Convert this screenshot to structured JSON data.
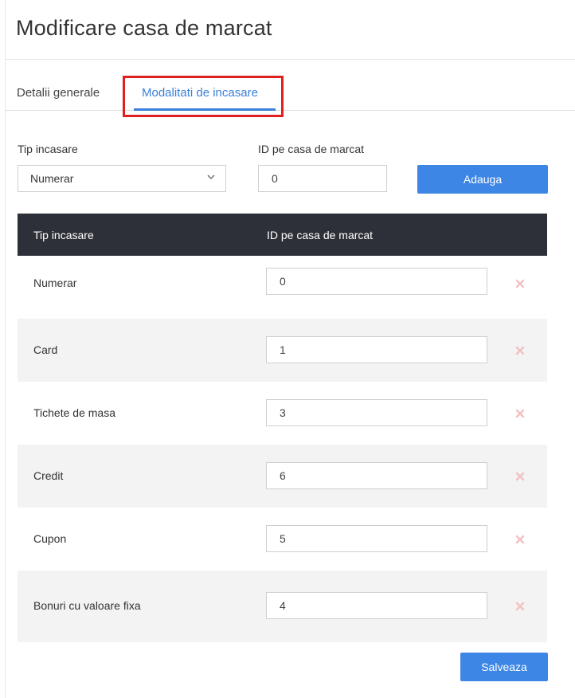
{
  "page": {
    "title": "Modificare casa de marcat"
  },
  "tabs": [
    {
      "label": "Detalii generale",
      "active": false
    },
    {
      "label": "Modalitati de incasare",
      "active": true
    }
  ],
  "form": {
    "type_label": "Tip incasare",
    "type_selected": "Numerar",
    "id_label": "ID pe casa de marcat",
    "id_value": "0",
    "add_button": "Adauga"
  },
  "table": {
    "headers": [
      "Tip incasare",
      "ID pe casa de marcat"
    ],
    "rows": [
      {
        "name": "Numerar",
        "id": "0"
      },
      {
        "name": "Card",
        "id": "1"
      },
      {
        "name": "Tichete de masa",
        "id": "3"
      },
      {
        "name": "Credit",
        "id": "6"
      },
      {
        "name": "Cupon",
        "id": "5"
      },
      {
        "name": "Bonuri cu valoare fixa",
        "id": "4"
      }
    ]
  },
  "footer": {
    "save_button": "Salveaza"
  },
  "colors": {
    "accent": "#3d86e5",
    "header_bg": "#2d3038",
    "highlight": "#e02020",
    "delete_icon": "#f4c0c0"
  },
  "icons": {
    "select_chevron": "chevron-down-icon",
    "row_delete": "close-icon"
  }
}
